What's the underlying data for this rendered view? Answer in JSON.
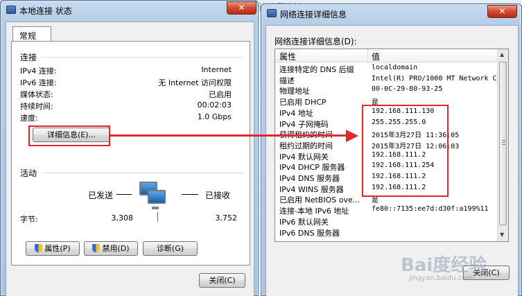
{
  "background_text": "计设置连接",
  "left_window": {
    "title": "本地连接 状态",
    "close_label": "✕",
    "tab_label": "常规",
    "connection_group": "连接",
    "rows": [
      {
        "label": "IPv4 连接:",
        "value": "Internet"
      },
      {
        "label": "IPv6 连接:",
        "value": "无 Internet 访问权限"
      },
      {
        "label": "媒体状态:",
        "value": "已启用"
      },
      {
        "label": "持续时间:",
        "value": "00:02:03"
      },
      {
        "label": "速度:",
        "value": "1.0 Gbps"
      }
    ],
    "details_button": "详细信息(E)...",
    "activity_group": "活动",
    "sent_label": "已发送",
    "received_label": "已接收",
    "bytes_label": "字节:",
    "bytes_sent": "3,308",
    "bytes_received": "3,752",
    "properties_button": "属性(P)",
    "disable_button": "禁用(D)",
    "diagnose_button": "诊断(G)",
    "close_button": "关闭(C)"
  },
  "right_window": {
    "title": "网络连接详细信息",
    "close_label": "✕",
    "list_label": "网络连接详细信息(D):",
    "col_property": "属性",
    "col_value": "值",
    "rows": [
      {
        "property": "连接特定的 DNS 后缀",
        "value": "localdomain"
      },
      {
        "property": "描述",
        "value": "Intel(R) PRO/1000 MT Network C"
      },
      {
        "property": "物理地址",
        "value": "00-0C-29-80-93-25"
      },
      {
        "property": "已启用 DHCP",
        "value": "是"
      },
      {
        "property": "IPv4 地址",
        "value": "192.168.111.130"
      },
      {
        "property": "IPv4 子网掩码",
        "value": "255.255.255.0"
      },
      {
        "property": "获得租约的时间",
        "value": "2015年3月27日 11:36:05"
      },
      {
        "property": "租约过期的时间",
        "value": "2015年3月27日 12:06:03"
      },
      {
        "property": "IPv4 默认网关",
        "value": "192.168.111.2"
      },
      {
        "property": "IPv4 DHCP 服务器",
        "value": "192.168.111.254"
      },
      {
        "property": "IPv4 DNS 服务器",
        "value": "192.168.111.2"
      },
      {
        "property": "IPv4 WINS 服务器",
        "value": "192.168.111.2"
      },
      {
        "property": "已启用 NetBIOS ove...",
        "value": "是"
      },
      {
        "property": "连接-本地 IPv6 地址",
        "value": "fe80::7135:ee7d:d30f:a199%11"
      },
      {
        "property": "IPv6 默认网关",
        "value": ""
      },
      {
        "property": "IPv6 DNS 服务器",
        "value": ""
      }
    ],
    "close_button": "关闭(C)"
  },
  "watermark": "Bai度经验",
  "watermark_sub": "jingyan.baidu.com",
  "colors": {
    "highlight": "#e2262b",
    "title_bar": "#b6cde6"
  }
}
